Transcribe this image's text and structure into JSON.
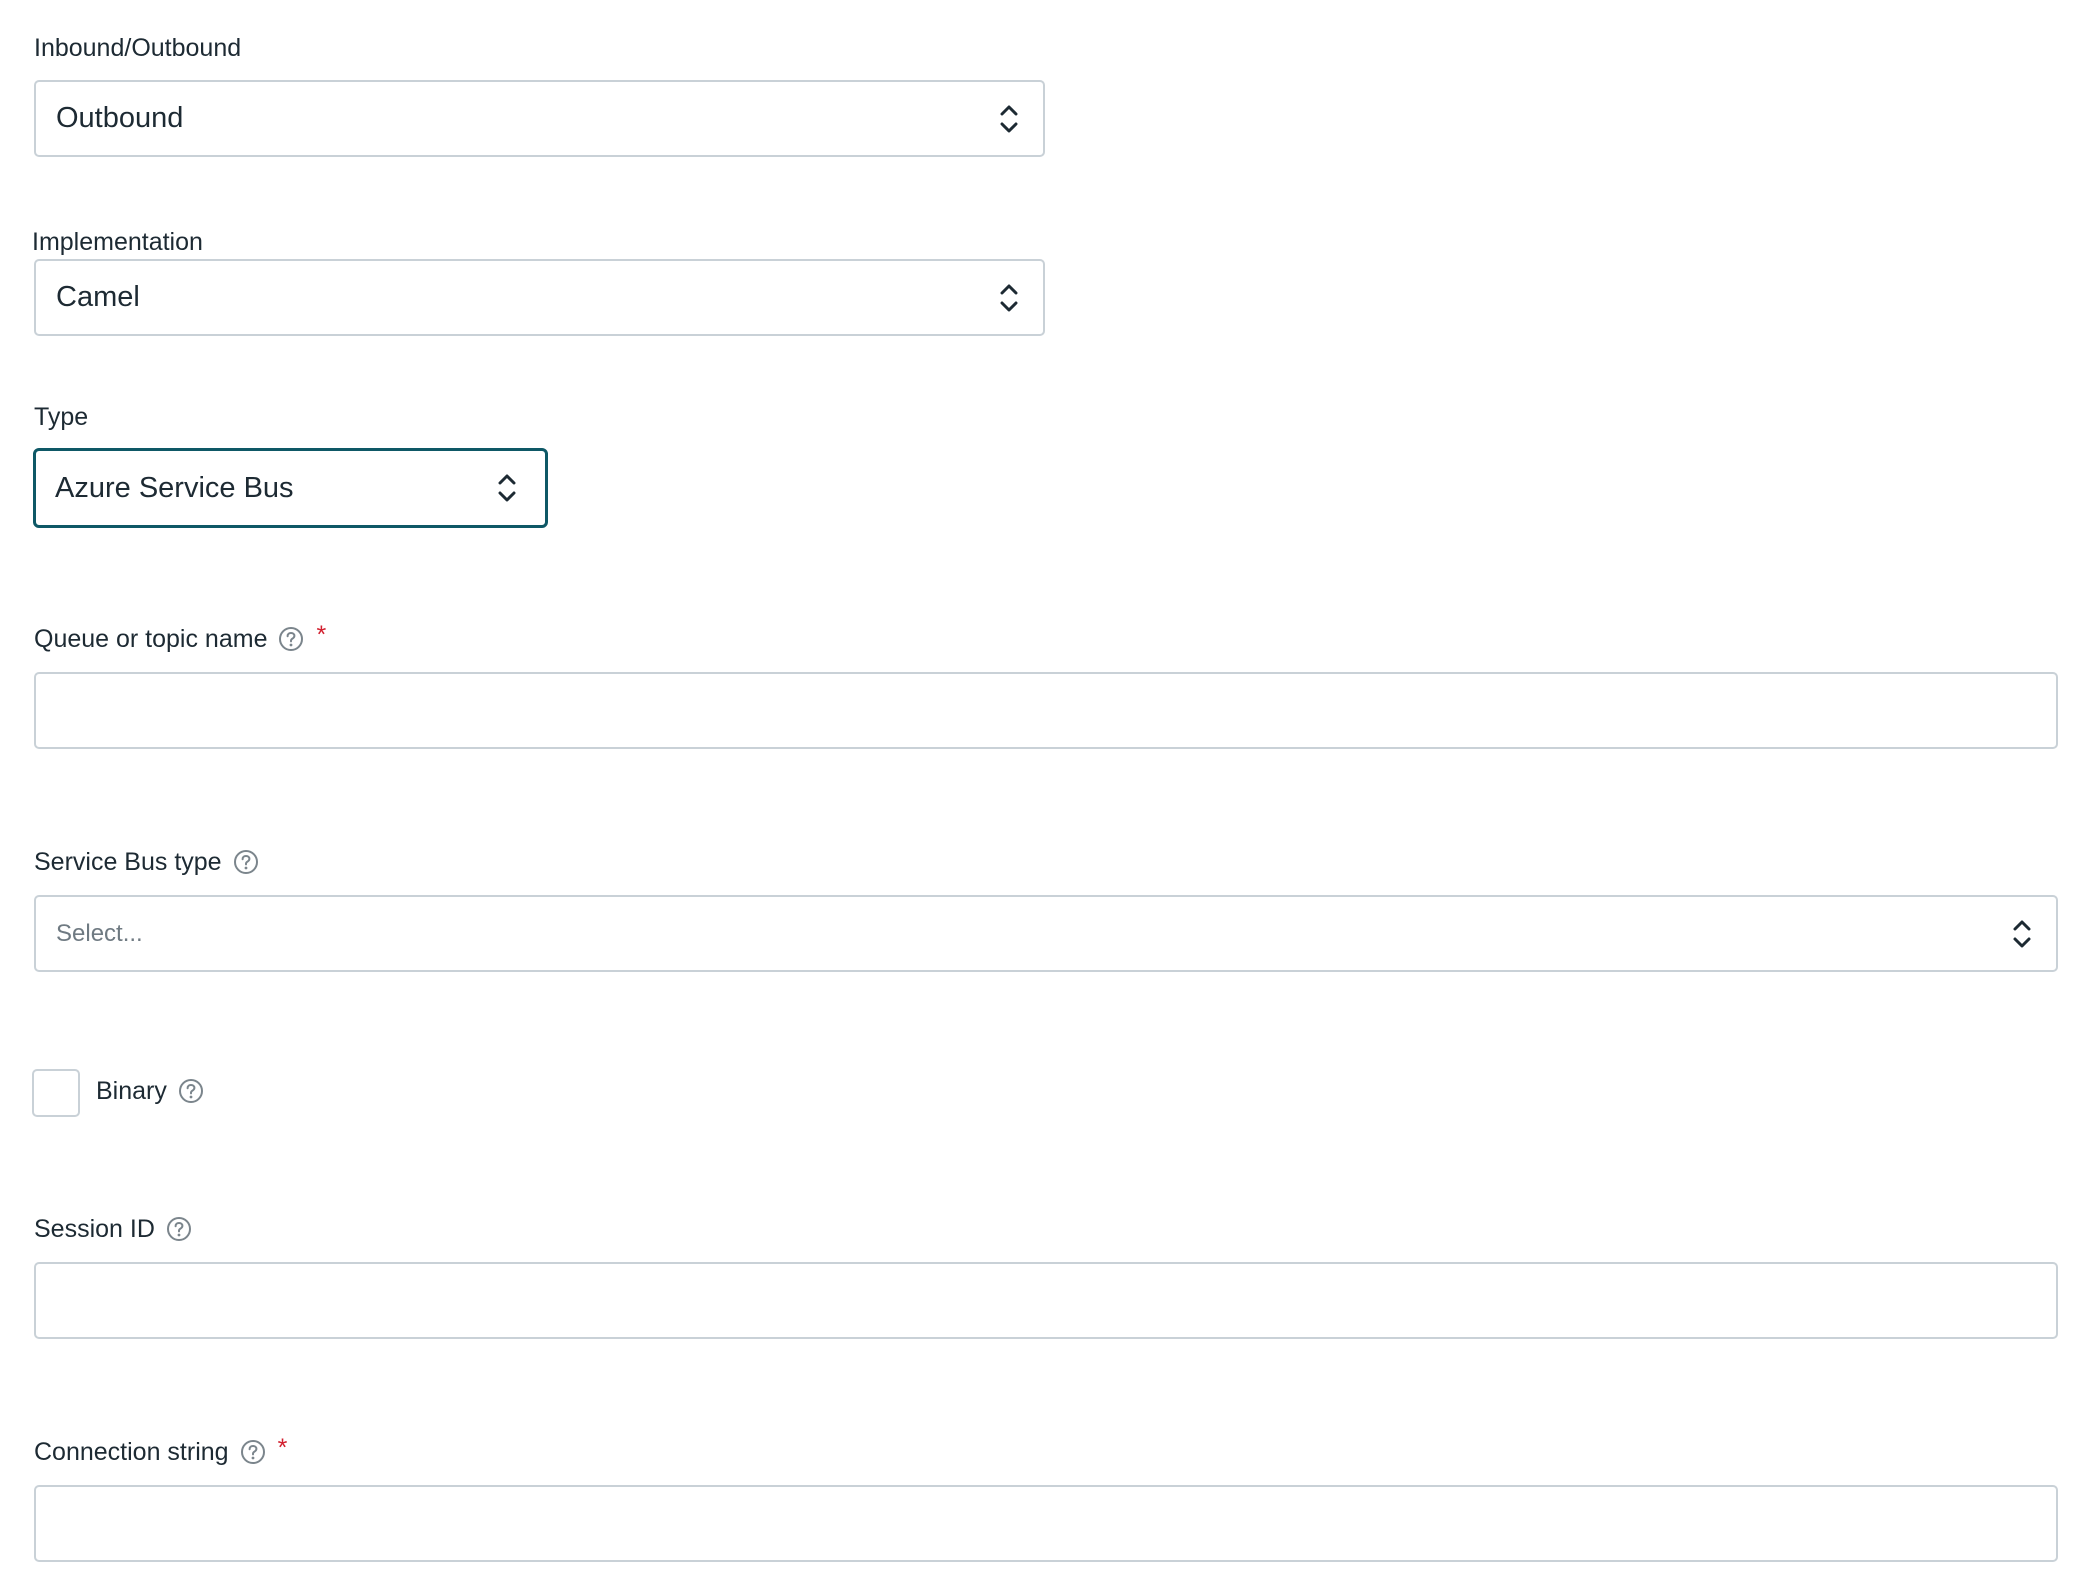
{
  "form": {
    "direction": {
      "label": "Inbound/Outbound",
      "value": "Outbound"
    },
    "implementation": {
      "label": "Implementation",
      "value": "Camel"
    },
    "type": {
      "label": "Type",
      "value": "Azure Service Bus"
    },
    "queue_name": {
      "label": "Queue or topic name",
      "required_mark": "*",
      "value": ""
    },
    "service_bus_type": {
      "label": "Service Bus type",
      "placeholder": "Select..."
    },
    "binary": {
      "label": "Binary",
      "checked": false
    },
    "session_id": {
      "label": "Session ID",
      "value": ""
    },
    "connection_string": {
      "label": "Connection string",
      "required_mark": "*",
      "value": ""
    }
  },
  "colors": {
    "text": "#1d2a33",
    "border": "#c9d1d7",
    "focus_border": "#0e5866",
    "required": "#d2202f",
    "placeholder": "#6f7a82"
  },
  "icons": {
    "help": "question-circle-icon",
    "select_arrows": "chevron-up-down-icon"
  }
}
